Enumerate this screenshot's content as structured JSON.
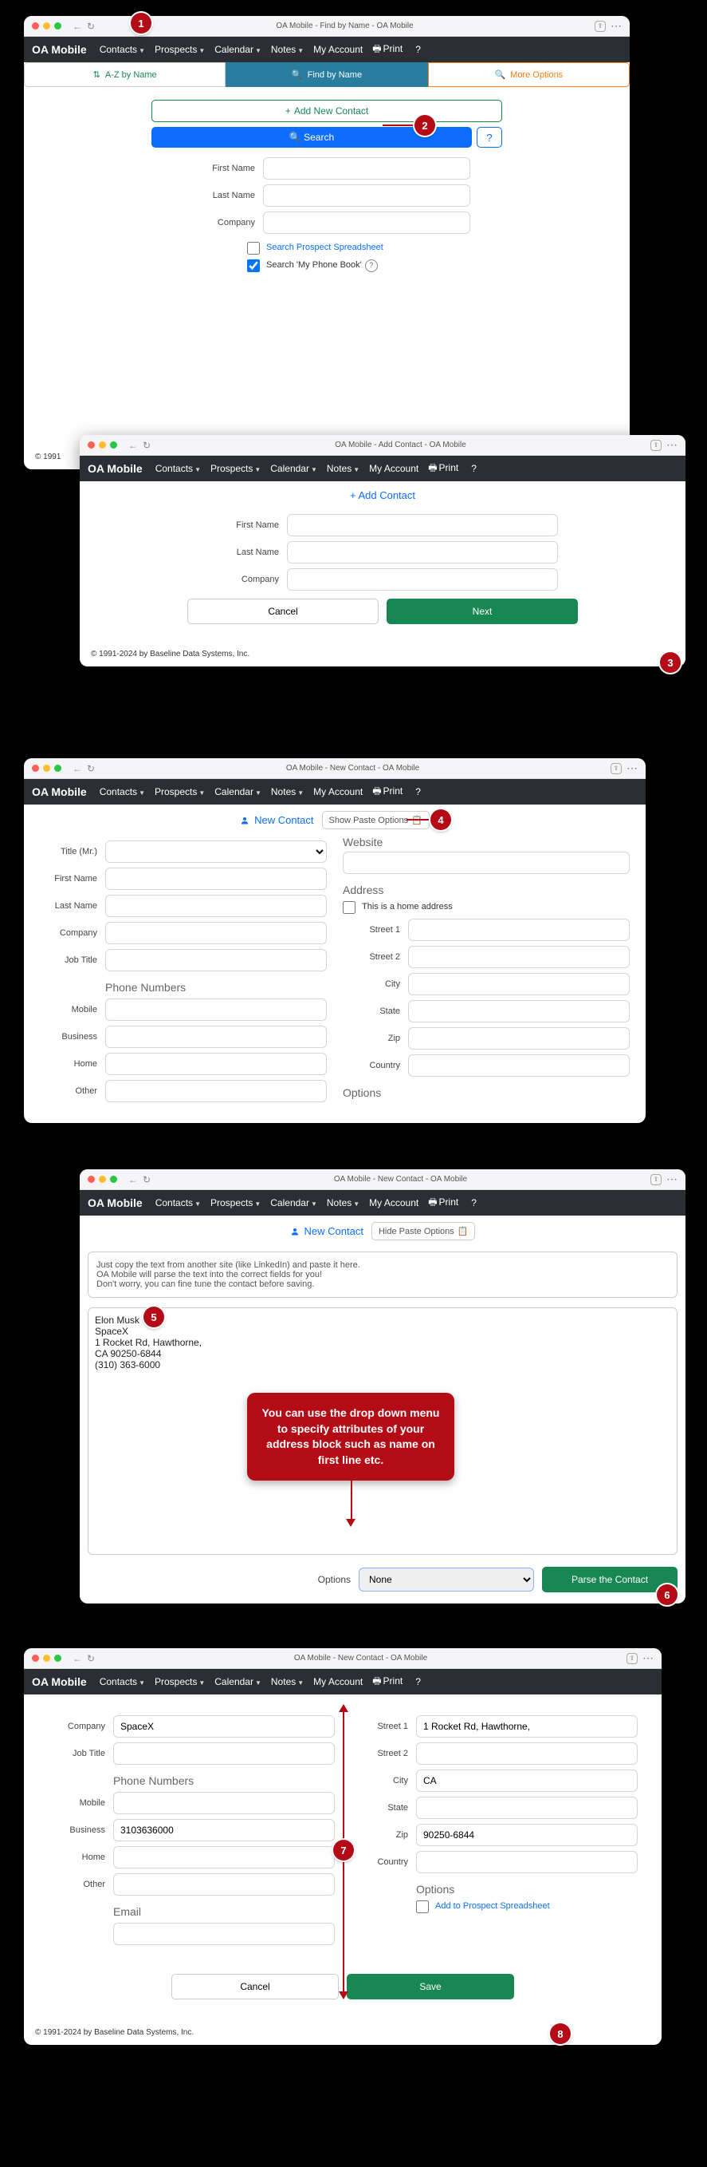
{
  "brand": "OA Mobile",
  "menu": {
    "contacts": "Contacts",
    "prospects": "Prospects",
    "calendar": "Calendar",
    "notes": "Notes",
    "myaccount": "My Account",
    "print": "Print",
    "help": "?"
  },
  "copyright": "© 1991-2024 by Baseline Data Systems, Inc.",
  "win1": {
    "title": "OA Mobile - Find by Name - OA Mobile",
    "tab_az": "A-Z by Name",
    "tab_find": "Find by Name",
    "tab_more": "More Options",
    "add_contact": "Add New Contact",
    "search": "Search",
    "first_name": "First Name",
    "last_name": "Last Name",
    "company": "Company",
    "chk_prospect": "Search Prospect Spreadsheet",
    "chk_phonebook": "Search 'My Phone Book'"
  },
  "win2": {
    "title": "OA Mobile - Add Contact - OA Mobile",
    "header": "+ Add Contact",
    "first_name": "First Name",
    "last_name": "Last Name",
    "company": "Company",
    "cancel": "Cancel",
    "next": "Next"
  },
  "win3": {
    "title": "OA Mobile - New Contact - OA Mobile",
    "header": "New Contact",
    "toggle": "Show Paste Options",
    "labels": {
      "title": "Title (Mr.)",
      "first_name": "First Name",
      "last_name": "Last Name",
      "company": "Company",
      "job_title": "Job Title",
      "phone_hdr": "Phone Numbers",
      "mobile": "Mobile",
      "business": "Business",
      "home": "Home",
      "other": "Other",
      "website_hdr": "Website",
      "address_hdr": "Address",
      "home_addr": "This is a home address",
      "street1": "Street 1",
      "street2": "Street 2",
      "city": "City",
      "state": "State",
      "zip": "Zip",
      "country": "Country",
      "options_hdr": "Options"
    }
  },
  "win4": {
    "title": "OA Mobile - New Contact - OA Mobile",
    "header": "New Contact",
    "toggle": "Hide Paste Options",
    "hint1": "Just copy the text from another site (like LinkedIn) and paste it here.",
    "hint2": "OA Mobile will parse the text into the correct fields for you!",
    "hint3": "Don't worry, you can fine tune the contact before saving.",
    "paste_text": "Elon Musk\nSpaceX\n1 Rocket Rd, Hawthorne,\nCA 90250-6844\n(310) 363-6000",
    "options_label": "Options",
    "options_value": "None",
    "parse_btn": "Parse the Contact",
    "speech": "You can use the drop down menu to specify attributes of your address block such as name on first line etc."
  },
  "win6": {
    "title": "OA Mobile - New Contact - OA Mobile",
    "labels": {
      "company": "Company",
      "job_title": "Job Title",
      "phone_hdr": "Phone Numbers",
      "mobile": "Mobile",
      "business": "Business",
      "home": "Home",
      "other": "Other",
      "email_hdr": "Email",
      "street1": "Street 1",
      "street2": "Street 2",
      "city": "City",
      "state": "State",
      "zip": "Zip",
      "country": "Country",
      "options_hdr": "Options",
      "add_prospect": "Add to Prospect Spreadsheet"
    },
    "values": {
      "company": "SpaceX",
      "business": "3103636000",
      "street1": "1 Rocket Rd, Hawthorne,",
      "city": "CA",
      "zip": "90250-6844"
    },
    "cancel": "Cancel",
    "save": "Save"
  },
  "nums": {
    "n1": "1",
    "n2": "2",
    "n3": "3",
    "n4": "4",
    "n5": "5",
    "n6": "6",
    "n7": "7",
    "n8": "8"
  }
}
